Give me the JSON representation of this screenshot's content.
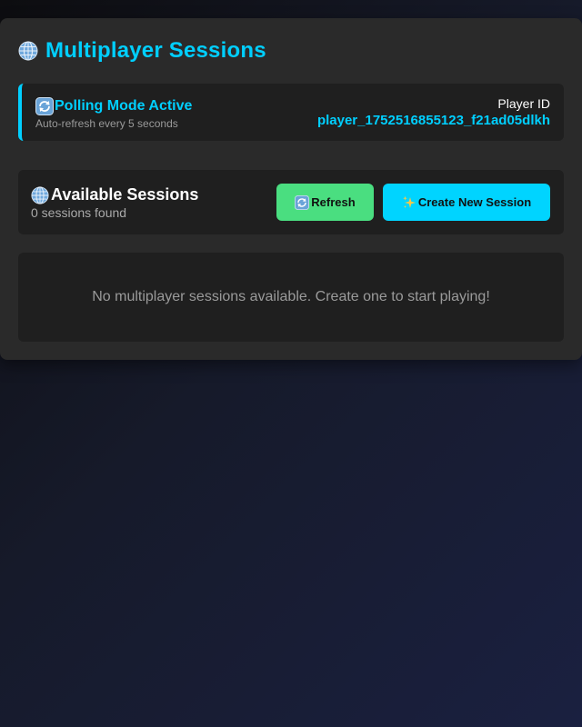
{
  "header": {
    "title": "Multiplayer Sessions",
    "icon": "globe-icon"
  },
  "status": {
    "icon": "refresh-icon",
    "title": "Polling Mode Active",
    "subtitle": "Auto-refresh every 5 seconds",
    "player_id_label": "Player ID",
    "player_id_value": "player_1752516855123_f21ad05dlkh"
  },
  "sessions": {
    "icon": "globe-icon",
    "title": "Available Sessions",
    "count_text": "0 sessions found",
    "refresh_label": "Refresh",
    "create_label": "Create New Session",
    "empty_message": "No multiplayer sessions available. Create one to start playing!"
  },
  "colors": {
    "accent": "#00cfff",
    "refresh_button": "#4ade80",
    "create_button": "#00d4ff",
    "panel": "#2a2a2a",
    "card": "#1f1f1f"
  }
}
